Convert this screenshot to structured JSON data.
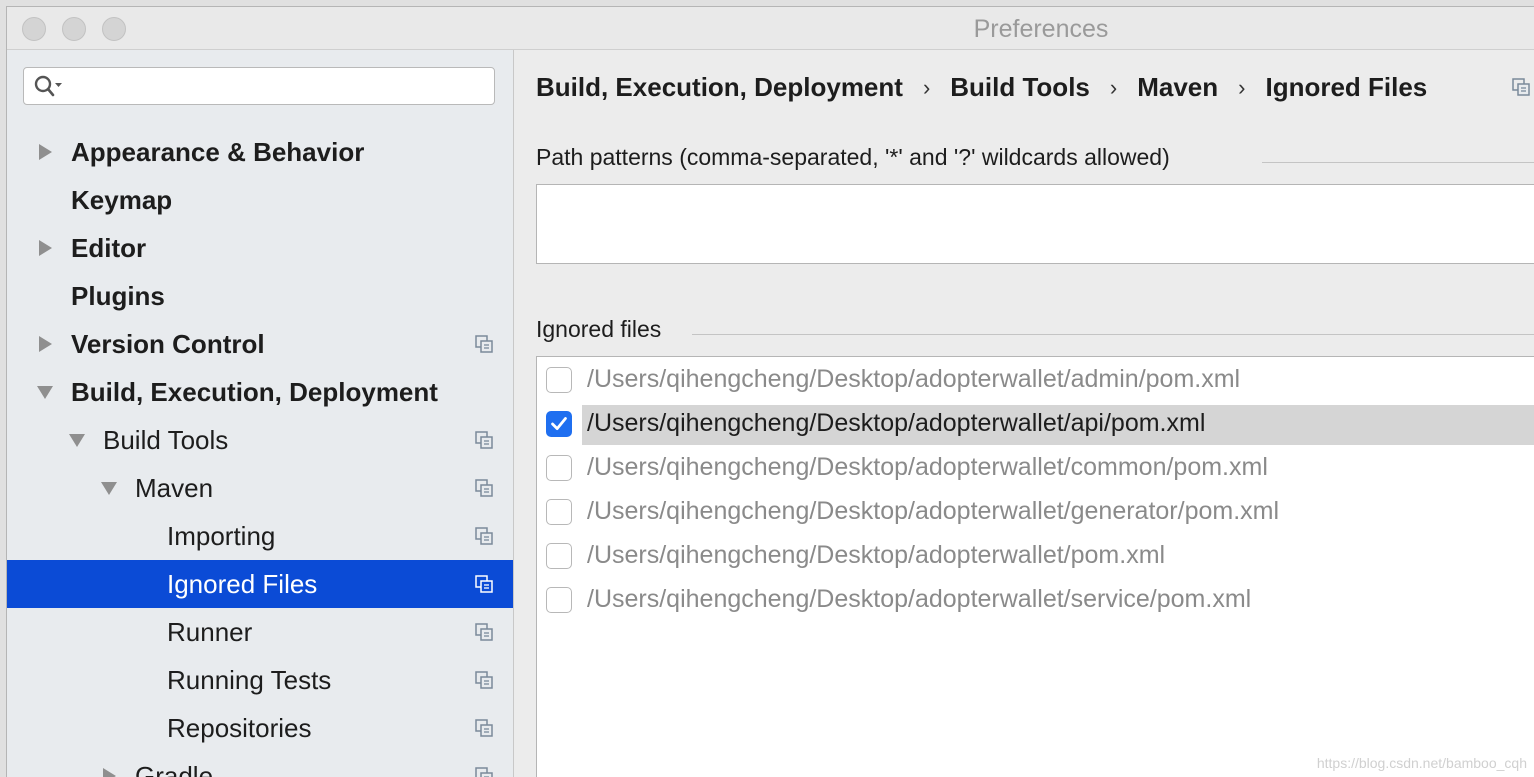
{
  "window": {
    "title": "Preferences"
  },
  "search": {
    "placeholder": ""
  },
  "sidebar": {
    "items": [
      {
        "label": "Appearance & Behavior",
        "bold": true,
        "arrow": "right",
        "indent": 0,
        "project_icon": false
      },
      {
        "label": "Keymap",
        "bold": true,
        "arrow": "none",
        "indent": 0,
        "project_icon": false
      },
      {
        "label": "Editor",
        "bold": true,
        "arrow": "right",
        "indent": 0,
        "project_icon": false
      },
      {
        "label": "Plugins",
        "bold": true,
        "arrow": "none",
        "indent": 0,
        "project_icon": false
      },
      {
        "label": "Version Control",
        "bold": true,
        "arrow": "right",
        "indent": 0,
        "project_icon": true
      },
      {
        "label": "Build, Execution, Deployment",
        "bold": true,
        "arrow": "down",
        "indent": 0,
        "project_icon": false
      },
      {
        "label": "Build Tools",
        "bold": false,
        "arrow": "down",
        "indent": 1,
        "project_icon": true
      },
      {
        "label": "Maven",
        "bold": false,
        "arrow": "down",
        "indent": 2,
        "project_icon": true
      },
      {
        "label": "Importing",
        "bold": false,
        "arrow": "none",
        "indent": 3,
        "project_icon": true
      },
      {
        "label": "Ignored Files",
        "bold": false,
        "arrow": "none",
        "indent": 3,
        "project_icon": true,
        "selected": true
      },
      {
        "label": "Runner",
        "bold": false,
        "arrow": "none",
        "indent": 3,
        "project_icon": true
      },
      {
        "label": "Running Tests",
        "bold": false,
        "arrow": "none",
        "indent": 3,
        "project_icon": true
      },
      {
        "label": "Repositories",
        "bold": false,
        "arrow": "none",
        "indent": 3,
        "project_icon": true
      },
      {
        "label": "Gradle",
        "bold": false,
        "arrow": "right",
        "indent": 2,
        "project_icon": true
      }
    ]
  },
  "breadcrumb": {
    "items": [
      "Build, Execution, Deployment",
      "Build Tools",
      "Maven",
      "Ignored Files"
    ],
    "separator": "›"
  },
  "path_patterns": {
    "label": "Path patterns (comma-separated, '*' and '?' wildcards allowed)",
    "value": ""
  },
  "ignored_files": {
    "label": "Ignored files",
    "files": [
      {
        "path": "/Users/qihengcheng/Desktop/adopterwallet/admin/pom.xml",
        "checked": false,
        "selected": false
      },
      {
        "path": "/Users/qihengcheng/Desktop/adopterwallet/api/pom.xml",
        "checked": true,
        "selected": true
      },
      {
        "path": "/Users/qihengcheng/Desktop/adopterwallet/common/pom.xml",
        "checked": false,
        "selected": false
      },
      {
        "path": "/Users/qihengcheng/Desktop/adopterwallet/generator/pom.xml",
        "checked": false,
        "selected": false
      },
      {
        "path": "/Users/qihengcheng/Desktop/adopterwallet/pom.xml",
        "checked": false,
        "selected": false
      },
      {
        "path": "/Users/qihengcheng/Desktop/adopterwallet/service/pom.xml",
        "checked": false,
        "selected": false
      }
    ]
  },
  "watermark": "https://blog.csdn.net/bamboo_cqh",
  "colors": {
    "selection": "#0b4bd6",
    "checkbox_checked": "#1f6ff0",
    "row_highlight": "#d5d5d5"
  }
}
